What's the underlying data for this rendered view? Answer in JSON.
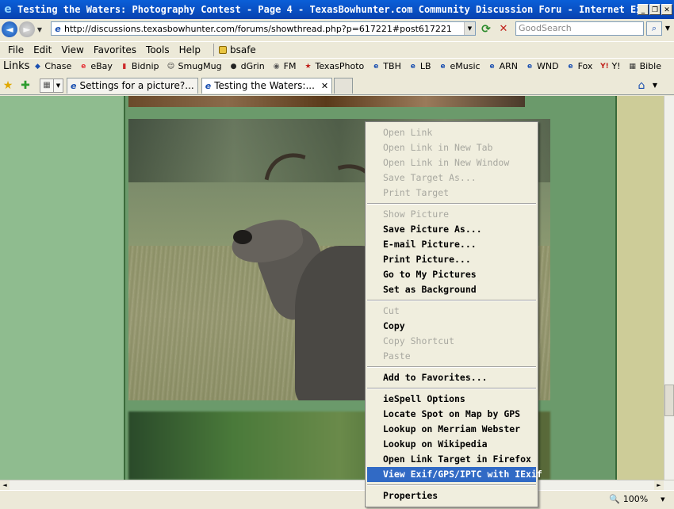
{
  "window": {
    "title": "Testing the Waters: Photography Contest - Page 4 - TexasBowhunter.com Community Discussion Foru - Internet Explorer",
    "min": "_",
    "max": "❐",
    "close": "✕"
  },
  "address": {
    "url": "http://discussions.texasbowhunter.com/forums/showthread.php?p=617221#post617221",
    "search_placeholder": "GoodSearch"
  },
  "menu": {
    "items": [
      "File",
      "Edit",
      "View",
      "Favorites",
      "Tools",
      "Help"
    ],
    "bsafe": "bsafe"
  },
  "links": {
    "label": "Links",
    "items": [
      {
        "label": "Chase",
        "icon": "◆",
        "color": "#1a4fb0"
      },
      {
        "label": "eBay",
        "icon": "e",
        "color": "#e53238"
      },
      {
        "label": "Bidnip",
        "icon": "▮",
        "color": "#cc2a2a"
      },
      {
        "label": "SmugMug",
        "icon": "☺",
        "color": "#333333"
      },
      {
        "label": "dGrin",
        "icon": "●",
        "color": "#222222"
      },
      {
        "label": "FM",
        "icon": "◉",
        "color": "#555555"
      },
      {
        "label": "TexasPhoto",
        "icon": "★",
        "color": "#c0201a"
      },
      {
        "label": "TBH",
        "icon": "e",
        "color": "#1a4fb0"
      },
      {
        "label": "LB",
        "icon": "e",
        "color": "#1a4fb0"
      },
      {
        "label": "eMusic",
        "icon": "e",
        "color": "#1a4fb0"
      },
      {
        "label": "ARN",
        "icon": "e",
        "color": "#1a4fb0"
      },
      {
        "label": "WND",
        "icon": "e",
        "color": "#1a4fb0"
      },
      {
        "label": "Fox",
        "icon": "e",
        "color": "#1a4fb0"
      },
      {
        "label": "Y!",
        "icon": "Y!",
        "color": "#c0201a"
      },
      {
        "label": "Bible",
        "icon": "▦",
        "color": "#333333"
      }
    ]
  },
  "tabs": {
    "items": [
      {
        "label": "Settings for a picture?...",
        "active": false
      },
      {
        "label": "Testing the Waters:...",
        "active": true
      }
    ],
    "close": "✕"
  },
  "context_menu": {
    "items": [
      {
        "label": "Open Link",
        "disabled": true
      },
      {
        "label": "Open Link in New Tab",
        "disabled": true
      },
      {
        "label": "Open Link in New Window",
        "disabled": true
      },
      {
        "label": "Save Target As...",
        "disabled": true
      },
      {
        "label": "Print Target",
        "disabled": true
      },
      {
        "sep": true
      },
      {
        "label": "Show Picture",
        "disabled": true
      },
      {
        "label": "Save Picture As...",
        "disabled": false
      },
      {
        "label": "E-mail Picture...",
        "disabled": false
      },
      {
        "label": "Print Picture...",
        "disabled": false
      },
      {
        "label": "Go to My Pictures",
        "disabled": false
      },
      {
        "label": "Set as Background",
        "disabled": false
      },
      {
        "sep": true
      },
      {
        "label": "Cut",
        "disabled": true
      },
      {
        "label": "Copy",
        "disabled": false
      },
      {
        "label": "Copy Shortcut",
        "disabled": true
      },
      {
        "label": "Paste",
        "disabled": true
      },
      {
        "sep": true
      },
      {
        "label": "Add to Favorites...",
        "disabled": false
      },
      {
        "sep": true
      },
      {
        "label": "ieSpell Options",
        "disabled": false
      },
      {
        "label": "Locate Spot on Map by GPS",
        "disabled": false
      },
      {
        "label": "Lookup on Merriam Webster",
        "disabled": false
      },
      {
        "label": "Lookup on Wikipedia",
        "disabled": false
      },
      {
        "label": "Open Link Target in Firefox",
        "disabled": false
      },
      {
        "label": "View Exif/GPS/IPTC with IExif",
        "disabled": false,
        "selected": true
      },
      {
        "sep": true
      },
      {
        "label": "Properties",
        "disabled": false
      }
    ]
  },
  "status": {
    "zoom": "100%"
  },
  "colors": {
    "page_bg": "#8fbc8f",
    "center_bg": "#6b9a6b",
    "right_bg": "#cdcc98",
    "highlight": "#316ac5"
  }
}
